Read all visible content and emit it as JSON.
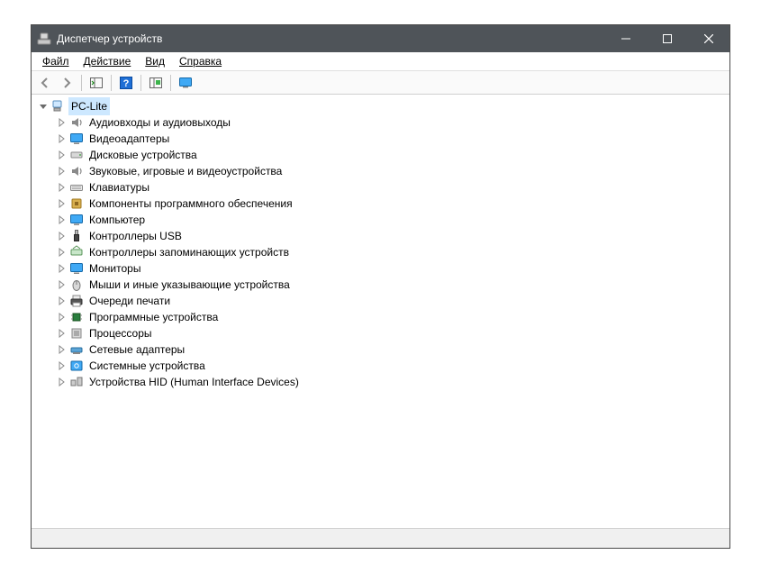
{
  "titlebar": {
    "title": "Диспетчер устройств"
  },
  "menu": {
    "file": "Файл",
    "action": "Действие",
    "view": "Вид",
    "help": "Справка"
  },
  "tree": {
    "root": "PC-Lite",
    "items": [
      {
        "label": "Аудиовходы и аудиовыходы",
        "icon": "audio"
      },
      {
        "label": "Видеоадаптеры",
        "icon": "display"
      },
      {
        "label": "Дисковые устройства",
        "icon": "disk"
      },
      {
        "label": "Звуковые, игровые и видеоустройства",
        "icon": "audio"
      },
      {
        "label": "Клавиатуры",
        "icon": "keyboard"
      },
      {
        "label": "Компоненты программного обеспечения",
        "icon": "software"
      },
      {
        "label": "Компьютер",
        "icon": "computer"
      },
      {
        "label": "Контроллеры USB",
        "icon": "usb"
      },
      {
        "label": "Контроллеры запоминающих устройств",
        "icon": "storage"
      },
      {
        "label": "Мониторы",
        "icon": "monitor"
      },
      {
        "label": "Мыши и иные указывающие устройства",
        "icon": "mouse"
      },
      {
        "label": "Очереди печати",
        "icon": "printer"
      },
      {
        "label": "Программные устройства",
        "icon": "chip"
      },
      {
        "label": "Процессоры",
        "icon": "cpu"
      },
      {
        "label": "Сетевые адаптеры",
        "icon": "network"
      },
      {
        "label": "Системные устройства",
        "icon": "system"
      },
      {
        "label": "Устройства HID (Human Interface Devices)",
        "icon": "hid"
      }
    ]
  }
}
